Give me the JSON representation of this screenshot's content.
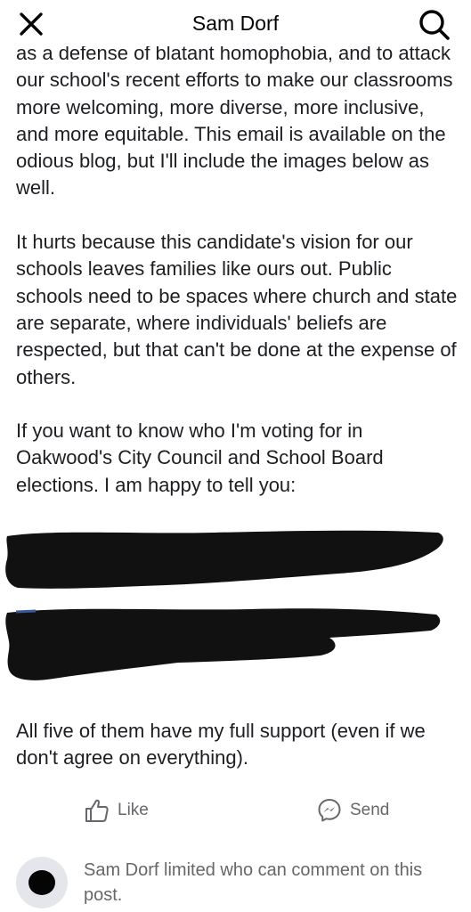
{
  "header": {
    "title": "Sam Dorf",
    "close_icon": "close-icon",
    "search_icon": "search-icon"
  },
  "post": {
    "paragraphs": [
      "as a defense of blatant homophobia, and to attack our school's recent efforts to make our classrooms more welcoming, more diverse, more inclusive, and more equitable. This email is available on the odious blog, but I'll include the images below as well.",
      "It hurts because this candidate's vision for our schools leaves families like ours out. Public schools need to be spaces where church and state are separate, where individuals' beliefs are respected, but that can't be done at the expense of others.",
      "If you want to know who I'm voting for in Oakwood's City Council and School Board elections. I am happy to tell you:"
    ],
    "closing": "All five of them have my full support (even if we don't agree on everything)."
  },
  "actions": {
    "like_label": "Like",
    "send_label": "Send",
    "like_icon": "thumbs-up-icon",
    "send_icon": "messenger-icon"
  },
  "comment_notice": {
    "name": "Sam Dorf",
    "text": " limited who can comment on this post."
  },
  "colors": {
    "text": "#1c1e21",
    "muted": "#65676b",
    "redaction": "#111111",
    "link_blue": "#385898"
  }
}
